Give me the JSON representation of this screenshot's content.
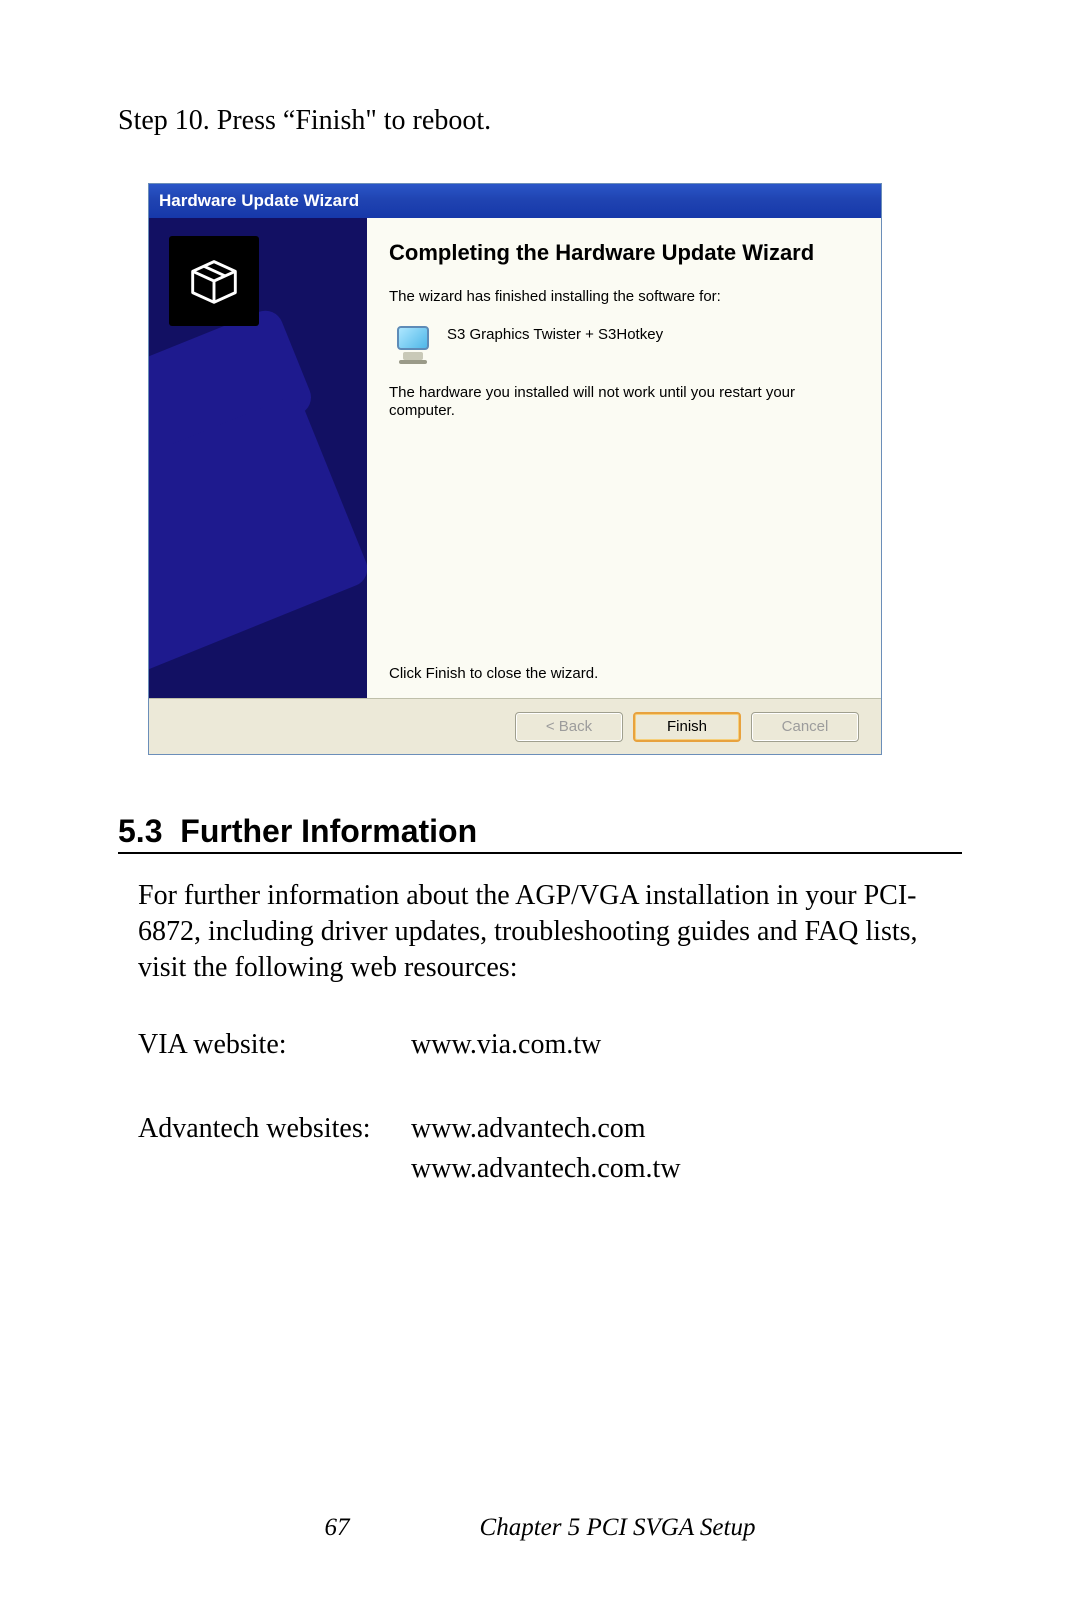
{
  "step_text": "Step 10.  Press “Finish\" to reboot.",
  "wizard": {
    "title": "Hardware Update Wizard",
    "heading": "Completing the Hardware Update Wizard",
    "finished_text": "The wizard has finished installing the software for:",
    "device_name": "S3 Graphics Twister + S3Hotkey",
    "restart_text": "The hardware you installed will not work until you restart your computer.",
    "close_hint": "Click Finish to close the wizard.",
    "buttons": {
      "back": "< Back",
      "finish": "Finish",
      "cancel": "Cancel"
    }
  },
  "section": {
    "number": "5.3",
    "title": "Further Information"
  },
  "body_paragraph": "For further information about the AGP/VGA installation in your PCI-6872, including driver updates, troubleshooting guides and FAQ lists, visit the following web resources:",
  "links": {
    "via_label": "VIA website:",
    "via_url": "www.via.com.tw",
    "advantech_label": "Advantech websites:",
    "advantech_url1": "www.advantech.com",
    "advantech_url2": "www.advantech.com.tw"
  },
  "footer": {
    "page_number": "67",
    "chapter": "Chapter 5  PCI SVGA Setup"
  }
}
